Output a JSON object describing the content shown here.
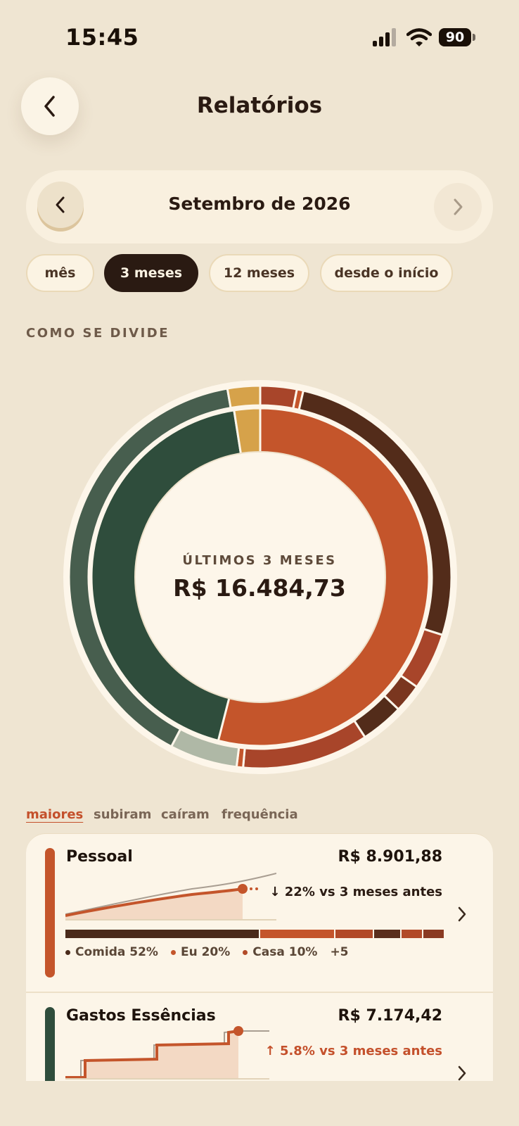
{
  "status": {
    "time": "15:45",
    "battery": "90"
  },
  "header": {
    "title": "Relatórios"
  },
  "period": {
    "label": "Setembro de 2026"
  },
  "ranges": [
    {
      "label": "mês",
      "active": false
    },
    {
      "label": "3 meses",
      "active": true
    },
    {
      "label": "12 meses",
      "active": false
    },
    {
      "label": "desde o início",
      "active": false
    }
  ],
  "section_label": "COMO SE DIVIDE",
  "summary": {
    "subtitle": "ÚLTIMOS 3 MESES",
    "total": "R$ 16.484,73"
  },
  "chart_data": {
    "type": "pie",
    "inner_ring": [
      {
        "category": "Pessoal",
        "value": 8901.88,
        "color": "#C4552B"
      },
      {
        "category": "Gastos Essências",
        "value": 7174.42,
        "color": "#2F4D3C"
      },
      {
        "category": "other",
        "value": 408.43,
        "color": "#D6A24A"
      }
    ],
    "outer_ring": [
      {
        "value": 2.8,
        "color": "#A8452A"
      },
      {
        "value": 0.5,
        "color": "#C4552B"
      },
      {
        "value": 23.9,
        "color": "#532C1A"
      },
      {
        "value": 4.4,
        "color": "#A8452A"
      },
      {
        "value": 2.2,
        "color": "#7A361F"
      },
      {
        "value": 3.3,
        "color": "#532C1A"
      },
      {
        "value": 9.7,
        "color": "#A8452A"
      },
      {
        "value": 0.5,
        "color": "#C4552B"
      },
      {
        "value": 5.2,
        "color": "#AFB8A6"
      },
      {
        "value": 36.0,
        "color": "#475E4E"
      },
      {
        "value": 2.5,
        "color": "#D6A24A"
      }
    ]
  },
  "sort_tabs": [
    {
      "label": "maiores",
      "active": true
    },
    {
      "label": "subiram",
      "active": false
    },
    {
      "label": "caíram",
      "active": false
    },
    {
      "label": "frequência",
      "active": false
    }
  ],
  "categories": [
    {
      "name": "Pessoal",
      "amount": "R$ 8.901,88",
      "delta": "↓ 22% vs 3 meses antes",
      "delta_color": "#2A1A12",
      "color": "#C4552B",
      "split": [
        {
          "share": 0.52,
          "color": "#4A2A1A"
        },
        {
          "share": 0.2,
          "color": "#C4552B"
        },
        {
          "share": 0.1,
          "color": "#B24A28"
        },
        {
          "share": 0.07,
          "color": "#5A2E1C"
        },
        {
          "share": 0.055,
          "color": "#B24A28"
        },
        {
          "share": 0.055,
          "color": "#8A3A22"
        }
      ],
      "legend": [
        {
          "label": "Comida 52%",
          "color": "#4A2A1A"
        },
        {
          "label": "Eu 20%",
          "color": "#C4552B"
        },
        {
          "label": "Casa 10%",
          "color": "#B24A28"
        }
      ],
      "legend_more": "+5"
    },
    {
      "name": "Gastos Essências",
      "amount": "R$ 7.174,42",
      "delta": "↑ 5.8% vs 3 meses antes",
      "delta_color": "#C4502B",
      "color": "#2F4D3C"
    }
  ]
}
